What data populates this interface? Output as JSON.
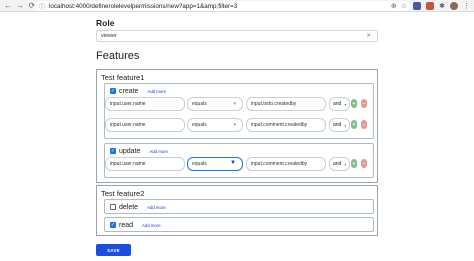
{
  "browser": {
    "url": "localhost:4000/definerolelevelpermissions/new?app=1&amp;filter=3"
  },
  "role": {
    "label": "Role",
    "value": "viewer"
  },
  "features_heading": "Features",
  "features": [
    {
      "title": "Test feature1",
      "permissions": [
        {
          "name": "create",
          "checked": true,
          "add_more": "Add more",
          "conditions": [
            {
              "left": "input.user.name",
              "op": "equals",
              "right": "input.todo.createdby",
              "join": "and"
            },
            {
              "left": "input.user.name",
              "op": "equals",
              "right": "input.comment.createdby",
              "join": "and"
            }
          ]
        },
        {
          "name": "update",
          "checked": true,
          "add_more": "Add more",
          "conditions": [
            {
              "left": "input.user.name",
              "op": "equals",
              "right": "input.comment.createdby",
              "join": "and"
            }
          ]
        }
      ]
    },
    {
      "title": "Test feature2",
      "permissions": [
        {
          "name": "delete",
          "checked": false,
          "add_more": "Add more",
          "conditions": []
        },
        {
          "name": "read",
          "checked": true,
          "add_more": "Add more",
          "conditions": []
        }
      ]
    }
  ],
  "save_label": "SAVE",
  "colors": {
    "primary": "#1a4fe0",
    "checkbox": "#1a73e8",
    "add_button": "#7fbf8a",
    "remove_button": "#e39a93",
    "link": "#1a3ad6"
  }
}
